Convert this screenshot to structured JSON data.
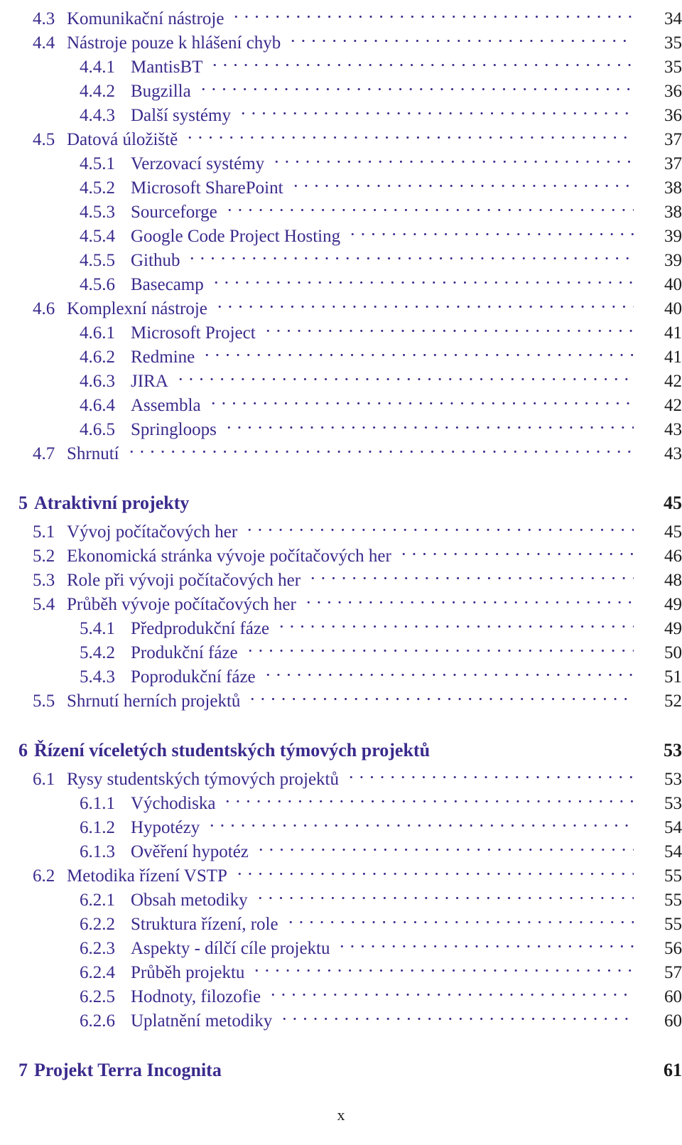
{
  "document": {
    "type": "table-of-contents",
    "language": "cs",
    "folio": "x",
    "text_color": "#3b2a8c",
    "page_number_color": "#1a1a1a"
  },
  "entries": [
    {
      "level": "section",
      "number": "4.3",
      "title": "Komunikační nástroje",
      "page": "34"
    },
    {
      "level": "section",
      "number": "4.4",
      "title": "Nástroje pouze k hlášení chyb",
      "page": "35"
    },
    {
      "level": "subsection",
      "number": "4.4.1",
      "title": "MantisBT",
      "page": "35"
    },
    {
      "level": "subsection",
      "number": "4.4.2",
      "title": "Bugzilla",
      "page": "36"
    },
    {
      "level": "subsection",
      "number": "4.4.3",
      "title": "Další systémy",
      "page": "36"
    },
    {
      "level": "section",
      "number": "4.5",
      "title": "Datová úložiště",
      "page": "37"
    },
    {
      "level": "subsection",
      "number": "4.5.1",
      "title": "Verzovací systémy",
      "page": "37"
    },
    {
      "level": "subsection",
      "number": "4.5.2",
      "title": "Microsoft SharePoint",
      "page": "38"
    },
    {
      "level": "subsection",
      "number": "4.5.3",
      "title": "Sourceforge",
      "page": "38"
    },
    {
      "level": "subsection",
      "number": "4.5.4",
      "title": "Google Code Project Hosting",
      "page": "39"
    },
    {
      "level": "subsection",
      "number": "4.5.5",
      "title": "Github",
      "page": "39"
    },
    {
      "level": "subsection",
      "number": "4.5.6",
      "title": "Basecamp",
      "page": "40"
    },
    {
      "level": "section",
      "number": "4.6",
      "title": "Komplexní nástroje",
      "page": "40"
    },
    {
      "level": "subsection",
      "number": "4.6.1",
      "title": "Microsoft Project",
      "page": "41"
    },
    {
      "level": "subsection",
      "number": "4.6.2",
      "title": "Redmine",
      "page": "41"
    },
    {
      "level": "subsection",
      "number": "4.6.3",
      "title": "JIRA",
      "page": "42"
    },
    {
      "level": "subsection",
      "number": "4.6.4",
      "title": "Assembla",
      "page": "42"
    },
    {
      "level": "subsection",
      "number": "4.6.5",
      "title": "Springloops",
      "page": "43"
    },
    {
      "level": "section",
      "number": "4.7",
      "title": "Shrnutí",
      "page": "43"
    },
    {
      "level": "gap"
    },
    {
      "level": "chapter",
      "number": "5",
      "title": "Atraktivní projekty",
      "page": "45"
    },
    {
      "level": "section",
      "number": "5.1",
      "title": "Vývoj počítačových her",
      "page": "45"
    },
    {
      "level": "section",
      "number": "5.2",
      "title": "Ekonomická stránka vývoje počítačových her",
      "page": "46"
    },
    {
      "level": "section",
      "number": "5.3",
      "title": "Role při vývoji počítačových her",
      "page": "48"
    },
    {
      "level": "section",
      "number": "5.4",
      "title": "Průběh vývoje počítačových her",
      "page": "49"
    },
    {
      "level": "subsection",
      "number": "5.4.1",
      "title": "Předprodukční fáze",
      "page": "49"
    },
    {
      "level": "subsection",
      "number": "5.4.2",
      "title": "Produkční fáze",
      "page": "50"
    },
    {
      "level": "subsection",
      "number": "5.4.3",
      "title": "Poprodukční fáze",
      "page": "51"
    },
    {
      "level": "section",
      "number": "5.5",
      "title": "Shrnutí herních projektů",
      "page": "52"
    },
    {
      "level": "gap"
    },
    {
      "level": "chapter",
      "number": "6",
      "title": "Řízení víceletých studentských týmových projektů",
      "page": "53"
    },
    {
      "level": "section",
      "number": "6.1",
      "title": "Rysy studentských týmových projektů",
      "page": "53"
    },
    {
      "level": "subsection",
      "number": "6.1.1",
      "title": "Východiska",
      "page": "53"
    },
    {
      "level": "subsection",
      "number": "6.1.2",
      "title": "Hypotézy",
      "page": "54"
    },
    {
      "level": "subsection",
      "number": "6.1.3",
      "title": "Ověření hypotéz",
      "page": "54"
    },
    {
      "level": "section",
      "number": "6.2",
      "title": "Metodika řízení VSTP",
      "page": "55"
    },
    {
      "level": "subsection",
      "number": "6.2.1",
      "title": "Obsah metodiky",
      "page": "55"
    },
    {
      "level": "subsection",
      "number": "6.2.2",
      "title": "Struktura řízení, role",
      "page": "55"
    },
    {
      "level": "subsection",
      "number": "6.2.3",
      "title": "Aspekty - dílčí cíle projektu",
      "page": "56"
    },
    {
      "level": "subsection",
      "number": "6.2.4",
      "title": "Průběh projektu",
      "page": "57"
    },
    {
      "level": "subsection",
      "number": "6.2.5",
      "title": "Hodnoty, filozofie",
      "page": "60"
    },
    {
      "level": "subsection",
      "number": "6.2.6",
      "title": "Uplatnění metodiky",
      "page": "60"
    },
    {
      "level": "gap"
    },
    {
      "level": "chapter",
      "number": "7",
      "title": "Projekt Terra Incognita",
      "page": "61"
    }
  ]
}
